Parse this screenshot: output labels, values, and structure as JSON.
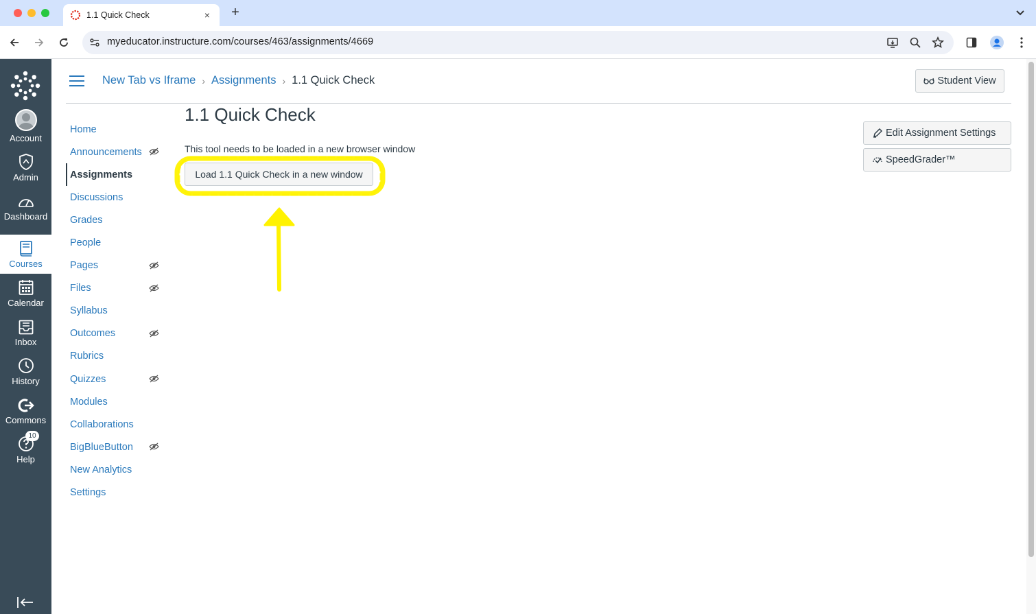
{
  "browser": {
    "tab_title": "1.1 Quick Check",
    "new_tab_symbol": "+",
    "tab_close_symbol": "×",
    "url": "myeducator.instructure.com/courses/463/assignments/4669"
  },
  "global_nav": {
    "items": [
      {
        "label": "Account",
        "icon": "avatar"
      },
      {
        "label": "Admin",
        "icon": "shield-icon"
      },
      {
        "label": "Dashboard",
        "icon": "dashboard-icon"
      },
      {
        "label": "Courses",
        "icon": "book-icon"
      },
      {
        "label": "Calendar",
        "icon": "calendar-icon"
      },
      {
        "label": "Inbox",
        "icon": "inbox-icon"
      },
      {
        "label": "History",
        "icon": "clock-icon"
      },
      {
        "label": "Commons",
        "icon": "commons-icon"
      },
      {
        "label": "Help",
        "icon": "help-icon"
      }
    ],
    "help_badge": "10",
    "active": "Courses"
  },
  "breadcrumb": {
    "course": "New Tab vs Iframe",
    "section": "Assignments",
    "current": "1.1 Quick Check"
  },
  "header": {
    "student_view_label": "Student View"
  },
  "course_nav": {
    "items": [
      {
        "label": "Home"
      },
      {
        "label": "Announcements",
        "hidden": true
      },
      {
        "label": "Assignments",
        "active": true
      },
      {
        "label": "Discussions"
      },
      {
        "label": "Grades"
      },
      {
        "label": "People"
      },
      {
        "label": "Pages",
        "hidden": true
      },
      {
        "label": "Files",
        "hidden": true
      },
      {
        "label": "Syllabus"
      },
      {
        "label": "Outcomes",
        "hidden": true
      },
      {
        "label": "Rubrics"
      },
      {
        "label": "Quizzes",
        "hidden": true
      },
      {
        "label": "Modules"
      },
      {
        "label": "Collaborations"
      },
      {
        "label": "BigBlueButton",
        "hidden": true
      },
      {
        "label": "New Analytics"
      },
      {
        "label": "Settings"
      }
    ]
  },
  "main": {
    "title": "1.1 Quick Check",
    "tool_message": "This tool needs to be loaded in a new browser window",
    "load_button_label": "Load 1.1 Quick Check in a new window"
  },
  "sidebar": {
    "edit_settings_label": "Edit Assignment Settings",
    "speedgrader_label": "SpeedGrader™"
  },
  "colors": {
    "global_nav_bg": "#394b58",
    "link": "#2b7abc",
    "text": "#2d3b45",
    "annotation": "#fff200"
  }
}
